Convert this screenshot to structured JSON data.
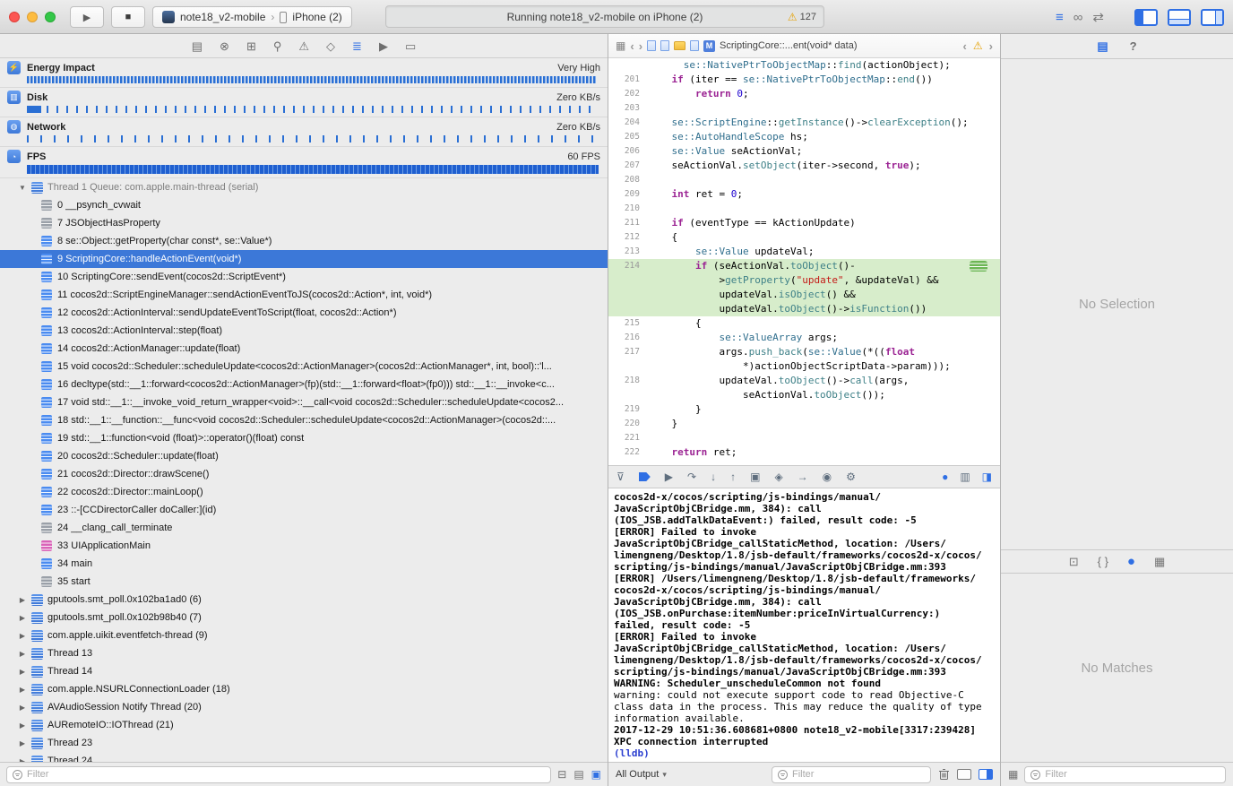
{
  "titlebar": {
    "scheme": "note18_v2-mobile",
    "device": "iPhone (2)",
    "status": "Running note18_v2-mobile on iPhone (2)",
    "warning_count": "127"
  },
  "toolbar_icons": {
    "run": "▶",
    "stop": "■",
    "standard_editor": "≡",
    "assistant_editor": "∞",
    "version_editor": "⇄",
    "scheme_chevron": "›"
  },
  "icons": {
    "disclosure_open": "▼",
    "disclosure_closed": "▶",
    "related_items": "▦",
    "back": "‹",
    "forward": "›",
    "m_badge": "M",
    "prev_issue": "‹",
    "next_issue": "›",
    "warning": "⚠",
    "output_chevron": "▾"
  },
  "navigator": {
    "tool_icons": [
      {
        "name": "project-navigator",
        "glyph": "▤"
      },
      {
        "name": "source-control-navigator",
        "glyph": "⊗"
      },
      {
        "name": "symbol-navigator",
        "glyph": "⊞"
      },
      {
        "name": "find-navigator",
        "glyph": "⚲"
      },
      {
        "name": "issue-navigator",
        "glyph": "⚠"
      },
      {
        "name": "test-navigator",
        "glyph": "◇"
      },
      {
        "name": "debug-navigator",
        "glyph": "≣",
        "active": true
      },
      {
        "name": "breakpoint-navigator",
        "glyph": "▶"
      },
      {
        "name": "report-navigator",
        "glyph": "▭"
      }
    ],
    "gauges": [
      {
        "label": "Energy Impact",
        "value": "Very High",
        "icon": "⚡",
        "bar": "bar-energy"
      },
      {
        "label": "Disk",
        "value": "Zero KB/s",
        "icon": "▥",
        "bar": "bar-disk"
      },
      {
        "label": "Network",
        "value": "Zero KB/s",
        "icon": "◍",
        "bar": "bar-network"
      },
      {
        "label": "FPS",
        "value": "60 FPS",
        "icon": "◔",
        "bar": "bar-fps"
      }
    ],
    "thread1_label": "Thread 1 Queue: com.apple.main-thread (serial)",
    "frames": [
      {
        "num": "0",
        "label": "__psynch_cvwait",
        "icon": "gray"
      },
      {
        "num": "7",
        "label": "JSObjectHasProperty",
        "icon": "gray"
      },
      {
        "num": "8",
        "label": "se::Object::getProperty(char const*, se::Value*)",
        "icon": "blue"
      },
      {
        "num": "9",
        "label": "ScriptingCore::handleActionEvent(void*)",
        "icon": "blue",
        "selected": true
      },
      {
        "num": "10",
        "label": "ScriptingCore::sendEvent(cocos2d::ScriptEvent*)",
        "icon": "blue"
      },
      {
        "num": "11",
        "label": "cocos2d::ScriptEngineManager::sendActionEventToJS(cocos2d::Action*, int, void*)",
        "icon": "blue"
      },
      {
        "num": "12",
        "label": "cocos2d::ActionInterval::sendUpdateEventToScript(float, cocos2d::Action*)",
        "icon": "blue"
      },
      {
        "num": "13",
        "label": "cocos2d::ActionInterval::step(float)",
        "icon": "blue"
      },
      {
        "num": "14",
        "label": "cocos2d::ActionManager::update(float)",
        "icon": "blue"
      },
      {
        "num": "15",
        "label": "void cocos2d::Scheduler::scheduleUpdate<cocos2d::ActionManager>(cocos2d::ActionManager*, int, bool)::'l...",
        "icon": "blue"
      },
      {
        "num": "16",
        "label": "decltype(std::__1::forward<cocos2d::ActionManager>(fp)(std::__1::forward<float>(fp0))) std::__1::__invoke<c...",
        "icon": "blue"
      },
      {
        "num": "17",
        "label": "void std::__1::__invoke_void_return_wrapper<void>::__call<void cocos2d::Scheduler::scheduleUpdate<cocos2...",
        "icon": "blue"
      },
      {
        "num": "18",
        "label": "std::__1::__function::__func<void cocos2d::Scheduler::scheduleUpdate<cocos2d::ActionManager>(cocos2d::...",
        "icon": "blue"
      },
      {
        "num": "19",
        "label": "std::__1::function<void (float)>::operator()(float) const",
        "icon": "blue"
      },
      {
        "num": "20",
        "label": "cocos2d::Scheduler::update(float)",
        "icon": "blue"
      },
      {
        "num": "21",
        "label": "cocos2d::Director::drawScene()",
        "icon": "blue"
      },
      {
        "num": "22",
        "label": "cocos2d::Director::mainLoop()",
        "icon": "blue"
      },
      {
        "num": "23",
        "label": "::-[CCDirectorCaller doCaller:](id)",
        "icon": "blue"
      },
      {
        "num": "24",
        "label": "__clang_call_terminate",
        "icon": "gray"
      },
      {
        "num": "33",
        "label": "UIApplicationMain",
        "icon": "pink"
      },
      {
        "num": "34",
        "label": "main",
        "icon": "blue"
      },
      {
        "num": "35",
        "label": "start",
        "icon": "gray"
      }
    ],
    "threads": [
      "gputools.smt_poll.0x102ba1ad0 (6)",
      "gputools.smt_poll.0x102b98b40 (7)",
      "com.apple.uikit.eventfetch-thread (9)",
      "Thread 13",
      "Thread 14",
      "com.apple.NSURLConnectionLoader (18)",
      "AVAudioSession Notify Thread (20)",
      "AURemoteIO::IOThread (21)",
      "Thread 23",
      "Thread 24"
    ],
    "filter_placeholder": "Filter",
    "bottom_icons": [
      {
        "name": "filter-crashed-blocks-button",
        "glyph": "⊟"
      },
      {
        "name": "view-mode-button",
        "glyph": "▤"
      },
      {
        "name": "view-process-by-queue-button",
        "glyph": "▣",
        "active": true
      }
    ]
  },
  "editor": {
    "breadcrumb_title": "ScriptingCore::...ent(void* data)",
    "rows": [
      {
        "n": "",
        "h": 0,
        "s": [
          [
            "      ",
            "p"
          ],
          [
            "se::NativePtrToObjectMap",
            "ty"
          ],
          [
            "::",
            "p"
          ],
          [
            "find",
            "fn"
          ],
          [
            "(actionObject);",
            "p"
          ]
        ]
      },
      {
        "n": "201",
        "h": 0,
        "s": [
          [
            "    ",
            "p"
          ],
          [
            "if",
            "k"
          ],
          [
            " (iter == ",
            "p"
          ],
          [
            "se::NativePtrToObjectMap",
            "ty"
          ],
          [
            "::",
            "p"
          ],
          [
            "end",
            "fn"
          ],
          [
            "())",
            "p"
          ]
        ]
      },
      {
        "n": "202",
        "h": 0,
        "s": [
          [
            "        ",
            "p"
          ],
          [
            "return",
            "k"
          ],
          [
            " ",
            "p"
          ],
          [
            "0",
            "nu"
          ],
          [
            ";",
            "p"
          ]
        ]
      },
      {
        "n": "203",
        "h": 0,
        "s": []
      },
      {
        "n": "204",
        "h": 0,
        "s": [
          [
            "    ",
            "p"
          ],
          [
            "se::ScriptEngine",
            "ty"
          ],
          [
            "::",
            "p"
          ],
          [
            "getInstance",
            "fn"
          ],
          [
            "()->",
            "p"
          ],
          [
            "clearException",
            "fn"
          ],
          [
            "();",
            "p"
          ]
        ]
      },
      {
        "n": "205",
        "h": 0,
        "s": [
          [
            "    ",
            "p"
          ],
          [
            "se::AutoHandleScope",
            "ty"
          ],
          [
            " hs;",
            "p"
          ]
        ]
      },
      {
        "n": "206",
        "h": 0,
        "s": [
          [
            "    ",
            "p"
          ],
          [
            "se::Value",
            "ty"
          ],
          [
            " seActionVal;",
            "p"
          ]
        ]
      },
      {
        "n": "207",
        "h": 0,
        "s": [
          [
            "    seActionVal.",
            "p"
          ],
          [
            "setObject",
            "fn"
          ],
          [
            "(iter->second, ",
            "p"
          ],
          [
            "true",
            "k"
          ],
          [
            ");",
            "p"
          ]
        ]
      },
      {
        "n": "208",
        "h": 0,
        "s": []
      },
      {
        "n": "209",
        "h": 0,
        "s": [
          [
            "    ",
            "p"
          ],
          [
            "int",
            "k"
          ],
          [
            " ret = ",
            "p"
          ],
          [
            "0",
            "nu"
          ],
          [
            ";",
            "p"
          ]
        ]
      },
      {
        "n": "210",
        "h": 0,
        "s": []
      },
      {
        "n": "211",
        "h": 0,
        "s": [
          [
            "    ",
            "p"
          ],
          [
            "if",
            "k"
          ],
          [
            " (eventType == kActionUpdate)",
            "p"
          ]
        ]
      },
      {
        "n": "212",
        "h": 0,
        "s": [
          [
            "    {",
            "p"
          ]
        ]
      },
      {
        "n": "213",
        "h": 0,
        "s": [
          [
            "        ",
            "p"
          ],
          [
            "se::Value",
            "ty"
          ],
          [
            " updateVal;",
            "p"
          ]
        ]
      },
      {
        "n": "214",
        "h": 1,
        "b": 1,
        "s": [
          [
            "        ",
            "p"
          ],
          [
            "if",
            "k"
          ],
          [
            " (seActionVal.",
            "p"
          ],
          [
            "toObject",
            "fn"
          ],
          [
            "()-",
            "p"
          ]
        ]
      },
      {
        "n": "",
        "h": 1,
        "s": [
          [
            "            >",
            "p"
          ],
          [
            "getProperty",
            "fn"
          ],
          [
            "(",
            "p"
          ],
          [
            "\"update\"",
            "st"
          ],
          [
            ", &updateVal) &&",
            "p"
          ]
        ]
      },
      {
        "n": "",
        "h": 1,
        "s": [
          [
            "            updateVal.",
            "p"
          ],
          [
            "isObject",
            "fn"
          ],
          [
            "() &&",
            "p"
          ]
        ]
      },
      {
        "n": "",
        "h": 1,
        "s": [
          [
            "            updateVal.",
            "p"
          ],
          [
            "toObject",
            "fn"
          ],
          [
            "()->",
            "p"
          ],
          [
            "isFunction",
            "fn"
          ],
          [
            "())",
            "p"
          ]
        ]
      },
      {
        "n": "215",
        "h": 0,
        "s": [
          [
            "        {",
            "p"
          ]
        ]
      },
      {
        "n": "216",
        "h": 0,
        "s": [
          [
            "            ",
            "p"
          ],
          [
            "se::ValueArray",
            "ty"
          ],
          [
            " args;",
            "p"
          ]
        ]
      },
      {
        "n": "217",
        "h": 0,
        "s": [
          [
            "            args.",
            "p"
          ],
          [
            "push_back",
            "fn"
          ],
          [
            "(",
            "p"
          ],
          [
            "se::Value",
            "ty"
          ],
          [
            "(*((",
            "p"
          ],
          [
            "float",
            "k"
          ]
        ]
      },
      {
        "n": "",
        "h": 0,
        "s": [
          [
            "                *)actionObjectScriptData->param)));",
            "p"
          ]
        ]
      },
      {
        "n": "218",
        "h": 0,
        "s": [
          [
            "            updateVal.",
            "p"
          ],
          [
            "toObject",
            "fn"
          ],
          [
            "()->",
            "p"
          ],
          [
            "call",
            "fn"
          ],
          [
            "(args,",
            "p"
          ]
        ]
      },
      {
        "n": "",
        "h": 0,
        "s": [
          [
            "                seActionVal.",
            "p"
          ],
          [
            "toObject",
            "fn"
          ],
          [
            "());",
            "p"
          ]
        ]
      },
      {
        "n": "219",
        "h": 0,
        "s": [
          [
            "        }",
            "p"
          ]
        ]
      },
      {
        "n": "220",
        "h": 0,
        "s": [
          [
            "    }",
            "p"
          ]
        ]
      },
      {
        "n": "221",
        "h": 0,
        "s": []
      },
      {
        "n": "222",
        "h": 0,
        "s": [
          [
            "    ",
            "p"
          ],
          [
            "return",
            "k"
          ],
          [
            " ret;",
            "p"
          ]
        ]
      }
    ]
  },
  "debug_bar": {
    "icons": [
      {
        "name": "hide-debug-area",
        "glyph": "⊽"
      },
      {
        "name": "breakpoints-toggle",
        "type": "bp"
      },
      {
        "name": "continue-execution",
        "glyph": "▶"
      },
      {
        "name": "step-over",
        "glyph": "↷"
      },
      {
        "name": "step-into",
        "glyph": "↓"
      },
      {
        "name": "step-out",
        "glyph": "↑"
      },
      {
        "name": "debug-view-hierarchy",
        "glyph": "▣"
      },
      {
        "name": "debug-memory-graph",
        "glyph": "◈"
      },
      {
        "name": "simulate-location",
        "glyph": "→"
      },
      {
        "name": "capture-screenshot",
        "glyph": "◉"
      },
      {
        "name": "debug-settings",
        "glyph": "⚙"
      }
    ],
    "right_icons": [
      {
        "name": "process-app",
        "glyph": "●",
        "blue": true
      },
      {
        "name": "cpu-report",
        "glyph": "▥"
      },
      {
        "name": "debug-area-layout",
        "glyph": "◨",
        "blue": true
      }
    ]
  },
  "console": {
    "output_selector": "All Output",
    "filter_placeholder": "Filter",
    "lines": [
      {
        "t": "cocos2d-x/cocos/scripting/js-bindings/manual/",
        "st": "b"
      },
      {
        "t": "JavaScriptObjCBridge.mm, 384): call",
        "st": "b"
      },
      {
        "t": "(IOS_JSB.addTalkDataEvent:) failed, result code: -5",
        "st": "b"
      },
      {
        "t": "[ERROR] Failed to invoke",
        "st": "b"
      },
      {
        "t": "JavaScriptObjCBridge_callStaticMethod, location: /Users/",
        "st": "b"
      },
      {
        "t": "limengneng/Desktop/1.8/jsb-default/frameworks/cocos2d-x/cocos/",
        "st": "b"
      },
      {
        "t": "scripting/js-bindings/manual/JavaScriptObjCBridge.mm:393",
        "st": "b"
      },
      {
        "t": "[ERROR] /Users/limengneng/Desktop/1.8/jsb-default/frameworks/",
        "st": "b"
      },
      {
        "t": "cocos2d-x/cocos/scripting/js-bindings/manual/",
        "st": "b"
      },
      {
        "t": "JavaScriptObjCBridge.mm, 384): call",
        "st": "b"
      },
      {
        "t": "(IOS_JSB.onPurchase:itemNumber:priceInVirtualCurrency:)",
        "st": "b"
      },
      {
        "t": "failed, result code: -5",
        "st": "b"
      },
      {
        "t": "[ERROR] Failed to invoke",
        "st": "b"
      },
      {
        "t": "JavaScriptObjCBridge_callStaticMethod, location: /Users/",
        "st": "b"
      },
      {
        "t": "limengneng/Desktop/1.8/jsb-default/frameworks/cocos2d-x/cocos/",
        "st": "b"
      },
      {
        "t": "scripting/js-bindings/manual/JavaScriptObjCBridge.mm:393",
        "st": "b"
      },
      {
        "t": "WARNING: Scheduler_unscheduleCommon not found",
        "st": "b"
      },
      {
        "t": "warning: could not execute support code to read Objective-C",
        "st": "r"
      },
      {
        "t": "class data in the process. This may reduce the quality of type",
        "st": "r"
      },
      {
        "t": "information available.",
        "st": "r"
      },
      {
        "t": "2017-12-29 10:51:36.608681+0800 note18_v2-mobile[3317:239428]",
        "st": "b"
      },
      {
        "t": "XPC connection interrupted",
        "st": "b"
      },
      {
        "t": "(lldb) ",
        "st": "l"
      }
    ]
  },
  "inspector": {
    "no_selection": "No Selection",
    "no_matches": "No Matches",
    "filter_placeholder": "Filter",
    "tabs": [
      {
        "name": "file-inspector",
        "glyph": "▤",
        "active": true
      },
      {
        "name": "quick-help-inspector",
        "glyph": "?"
      }
    ],
    "library_icons": [
      {
        "name": "file-template-library",
        "glyph": "⊡"
      },
      {
        "name": "code-snippet-library",
        "glyph": "{ }"
      },
      {
        "name": "object-library",
        "glyph": "●",
        "active": true
      },
      {
        "name": "media-library",
        "glyph": "▦"
      }
    ],
    "grid_button_glyph": "▦"
  }
}
